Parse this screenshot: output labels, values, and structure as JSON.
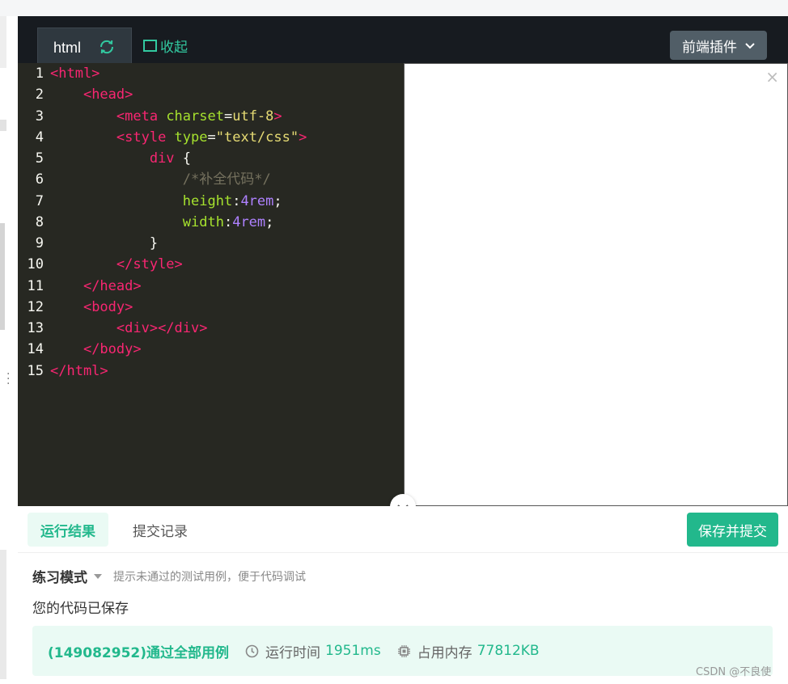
{
  "editor": {
    "tab_label": "html",
    "collapse_label": "收起",
    "plugin_label": "前端插件",
    "preview_close": "×",
    "lines": [
      {
        "n": "1",
        "parts": [
          {
            "c": "t-tag",
            "t": "<html>"
          }
        ]
      },
      {
        "n": "2",
        "parts": [
          {
            "c": "t-plain",
            "t": "    "
          },
          {
            "c": "t-tag",
            "t": "<head>"
          }
        ]
      },
      {
        "n": "3",
        "parts": [
          {
            "c": "t-plain",
            "t": "        "
          },
          {
            "c": "t-tag",
            "t": "<meta "
          },
          {
            "c": "t-attr",
            "t": "charset"
          },
          {
            "c": "t-plain",
            "t": "="
          },
          {
            "c": "t-str",
            "t": "utf-8"
          },
          {
            "c": "t-tag",
            "t": ">"
          }
        ]
      },
      {
        "n": "4",
        "parts": [
          {
            "c": "t-plain",
            "t": "        "
          },
          {
            "c": "t-tag",
            "t": "<style "
          },
          {
            "c": "t-attr",
            "t": "type"
          },
          {
            "c": "t-plain",
            "t": "="
          },
          {
            "c": "t-str",
            "t": "\"text/css\""
          },
          {
            "c": "t-tag",
            "t": ">"
          }
        ]
      },
      {
        "n": "5",
        "parts": [
          {
            "c": "t-plain",
            "t": "            "
          },
          {
            "c": "t-sel",
            "t": "div"
          },
          {
            "c": "t-plain",
            "t": " {"
          }
        ]
      },
      {
        "n": "6",
        "parts": [
          {
            "c": "t-plain",
            "t": "                "
          },
          {
            "c": "t-comment",
            "t": "/*补全代码*/"
          }
        ]
      },
      {
        "n": "7",
        "parts": [
          {
            "c": "t-plain",
            "t": "                "
          },
          {
            "c": "t-prop",
            "t": "height"
          },
          {
            "c": "t-plain",
            "t": ":"
          },
          {
            "c": "t-num",
            "t": "4rem"
          },
          {
            "c": "t-plain",
            "t": ";"
          }
        ]
      },
      {
        "n": "8",
        "parts": [
          {
            "c": "t-plain",
            "t": "                "
          },
          {
            "c": "t-prop",
            "t": "width"
          },
          {
            "c": "t-plain",
            "t": ":"
          },
          {
            "c": "t-num",
            "t": "4rem"
          },
          {
            "c": "t-plain",
            "t": ";"
          }
        ]
      },
      {
        "n": "9",
        "parts": [
          {
            "c": "t-plain",
            "t": "            }"
          }
        ]
      },
      {
        "n": "10",
        "parts": [
          {
            "c": "t-plain",
            "t": "        "
          },
          {
            "c": "t-tag",
            "t": "</style>"
          }
        ]
      },
      {
        "n": "11",
        "parts": [
          {
            "c": "t-plain",
            "t": "    "
          },
          {
            "c": "t-tag",
            "t": "</head>"
          }
        ]
      },
      {
        "n": "12",
        "parts": [
          {
            "c": "t-plain",
            "t": "    "
          },
          {
            "c": "t-tag",
            "t": "<body>"
          }
        ]
      },
      {
        "n": "13",
        "parts": [
          {
            "c": "t-plain",
            "t": "        "
          },
          {
            "c": "t-tag",
            "t": "<div></div>"
          }
        ]
      },
      {
        "n": "14",
        "parts": [
          {
            "c": "t-plain",
            "t": "    "
          },
          {
            "c": "t-tag",
            "t": "</body>"
          }
        ]
      },
      {
        "n": "15",
        "parts": [
          {
            "c": "t-tag",
            "t": "</html>"
          }
        ]
      }
    ]
  },
  "tabs": {
    "result": "运行结果",
    "history": "提交记录",
    "submit": "保存并提交"
  },
  "mode": {
    "label": "练习模式",
    "hint": "提示未通过的测试用例，便于代码调试"
  },
  "saved_message": "您的代码已保存",
  "result": {
    "pass_text": "(149082952)通过全部用例",
    "time_label": "运行时间",
    "time_value": "1951ms",
    "memory_label": "占用内存",
    "memory_value": "77812KB"
  },
  "watermark": "CSDN @不良使",
  "colors": {
    "accent": "#22b88c",
    "editor_bg": "#272822",
    "topbar_bg": "#171b20"
  },
  "icons": {
    "refresh": "refresh-icon",
    "collapse": "collapse-icon",
    "chevron": "chevron-down-icon",
    "clock": "clock-icon",
    "chip": "chip-icon"
  }
}
